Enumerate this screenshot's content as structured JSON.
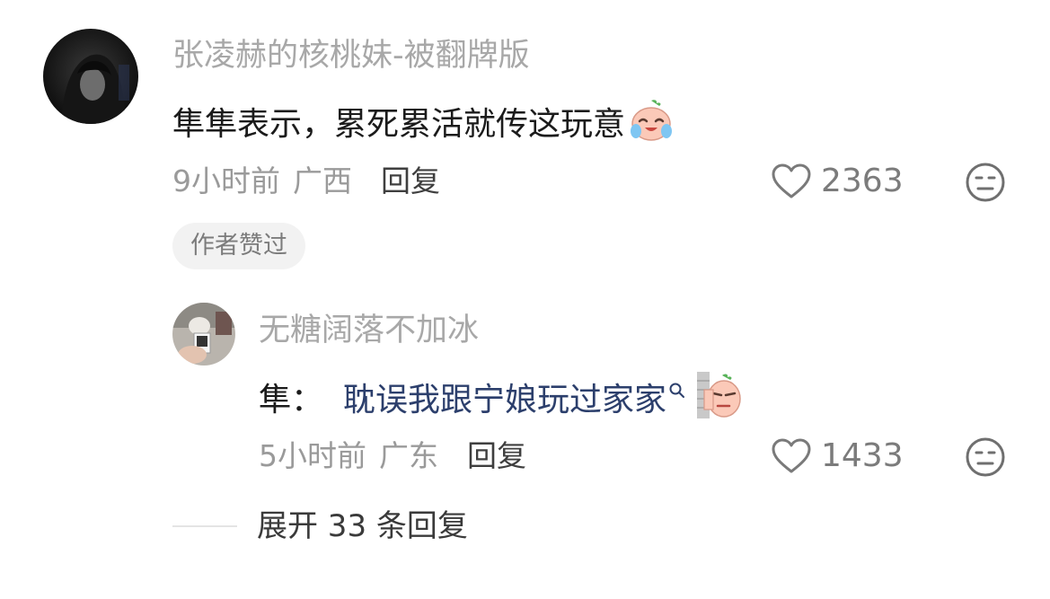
{
  "comments": [
    {
      "username": "张凌赫的核桃妹-被翻牌版",
      "text": "隼隼表示，累死累活就传这玩意",
      "emoji_icon": "crying-face-emoji-icon",
      "time": "9小时前",
      "location": "广西",
      "reply_label": "回复",
      "likes": "2363",
      "badge": "作者赞过"
    },
    {
      "username": "无糖阔落不加冰",
      "reply_prefix": "隼：",
      "link_text": "耽误我跟宁娘玩过家家",
      "link_icon": "search-icon",
      "emoji_icon": "peeking-face-emoji-icon",
      "time": "5小时前",
      "location": "广东",
      "reply_label": "回复",
      "likes": "1433"
    }
  ],
  "expand_label": "展开 33 条回复"
}
